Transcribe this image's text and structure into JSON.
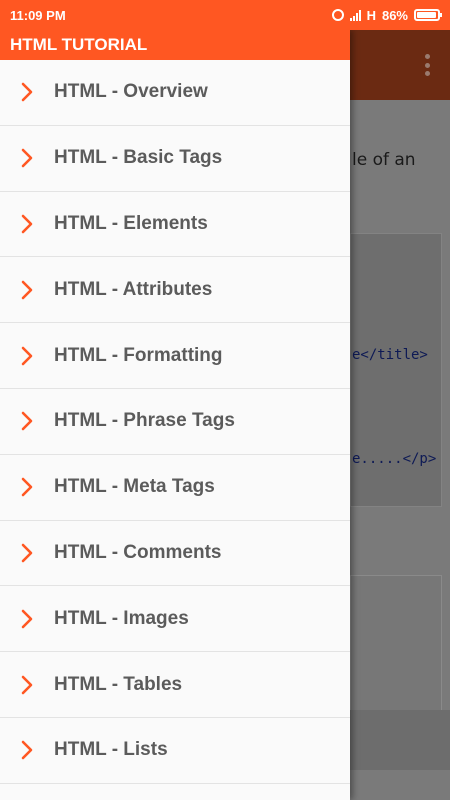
{
  "status_bar": {
    "time": "11:09 PM",
    "network": "H",
    "battery": "86%",
    "battery_level": 0.86
  },
  "drawer": {
    "title": "HTML TUTORIAL",
    "items": [
      {
        "label": "HTML - Overview"
      },
      {
        "label": "HTML - Basic Tags"
      },
      {
        "label": "HTML - Elements"
      },
      {
        "label": "HTML - Attributes"
      },
      {
        "label": "HTML - Formatting"
      },
      {
        "label": "HTML - Phrase Tags"
      },
      {
        "label": "HTML - Meta Tags"
      },
      {
        "label": "HTML - Comments"
      },
      {
        "label": "HTML - Images"
      },
      {
        "label": "HTML - Tables"
      },
      {
        "label": "HTML - Lists"
      }
    ]
  },
  "background": {
    "partial_text": "le of an",
    "code_lines": [
      "e</title>",
      "e.....</p>"
    ]
  },
  "colors": {
    "accent": "#FF5722",
    "toolbar_dim": "#6b2a12",
    "item_text": "#5b5b5b"
  }
}
